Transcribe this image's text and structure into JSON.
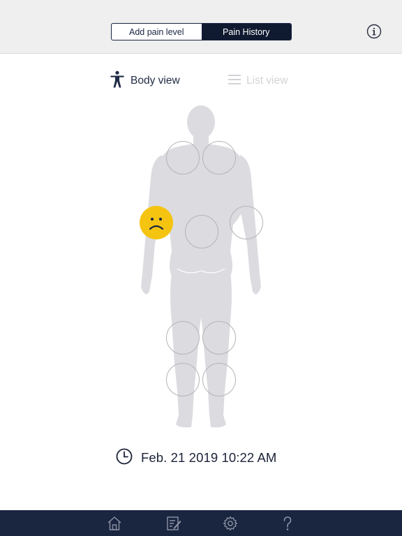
{
  "header": {
    "segments": [
      {
        "label": "Add pain level",
        "active": false
      },
      {
        "label": "Pain History",
        "active": true
      }
    ],
    "info_icon": "info-circle-icon"
  },
  "views": {
    "body_view_label": "Body view",
    "list_view_label": "List view",
    "active": "body"
  },
  "body_map": {
    "spots": [
      {
        "region": "left-shoulder",
        "state": "empty"
      },
      {
        "region": "right-shoulder",
        "state": "empty"
      },
      {
        "region": "left-elbow",
        "state": "pain",
        "face": "sad"
      },
      {
        "region": "lower-back",
        "state": "empty"
      },
      {
        "region": "right-elbow",
        "state": "empty"
      },
      {
        "region": "left-thigh",
        "state": "empty"
      },
      {
        "region": "right-thigh",
        "state": "empty"
      },
      {
        "region": "left-calf",
        "state": "empty"
      },
      {
        "region": "right-calf",
        "state": "empty"
      }
    ]
  },
  "timestamp": {
    "icon": "clock-icon",
    "text": "Feb. 21 2019 10:22 AM"
  },
  "tabbar": {
    "items": [
      {
        "name": "home",
        "icon": "home-icon"
      },
      {
        "name": "journal",
        "icon": "edit-notes-icon"
      },
      {
        "name": "settings",
        "icon": "gear-icon"
      },
      {
        "name": "help",
        "icon": "question-icon"
      }
    ]
  },
  "colors": {
    "navy": "#1a2540",
    "pain_yellow": "#f4c411",
    "body_gray": "#dcdce0",
    "spot_border": "#b4b4b8"
  }
}
